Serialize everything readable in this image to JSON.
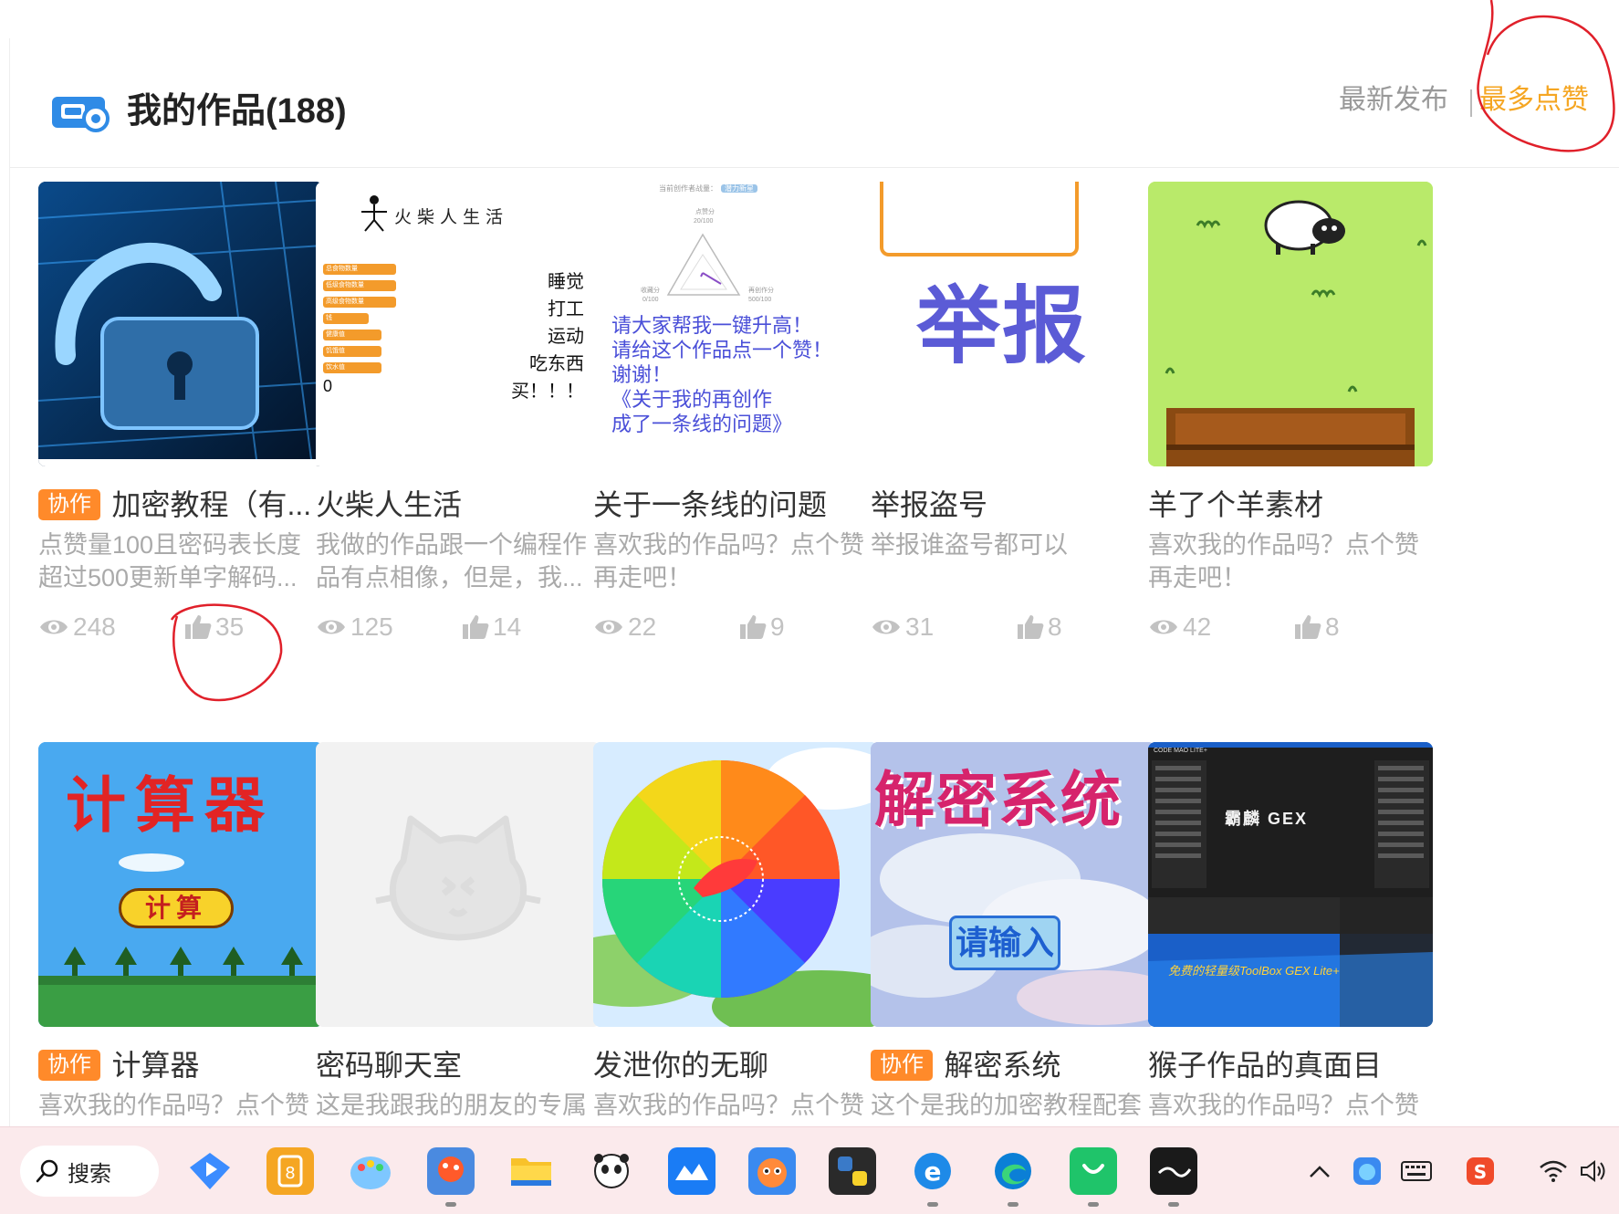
{
  "header": {
    "title": "我的作品(188)",
    "sort_latest": "最新发布",
    "sort_most_liked": "最多点赞"
  },
  "works": [
    {
      "collab": true,
      "badge": "协作",
      "title": "加密教程（有...",
      "desc": "点赞量100且密码表长度超过500更新单字解码...",
      "views": "248",
      "likes": "35"
    },
    {
      "collab": false,
      "badge": "",
      "title": "火柴人生活",
      "desc": "我做的作品跟一个编程作品有点相像，但是，我...",
      "views": "125",
      "likes": "14"
    },
    {
      "collab": false,
      "badge": "",
      "title": "关于一条线的问题",
      "desc": "喜欢我的作品吗？点个赞再走吧！",
      "views": "22",
      "likes": "9"
    },
    {
      "collab": false,
      "badge": "",
      "title": "举报盗号",
      "desc": "举报谁盗号都可以",
      "views": "31",
      "likes": "8"
    },
    {
      "collab": false,
      "badge": "",
      "title": "羊了个羊素材",
      "desc": "喜欢我的作品吗？点个赞再走吧！",
      "views": "42",
      "likes": "8"
    },
    {
      "collab": true,
      "badge": "协作",
      "title": "计算器",
      "desc": "喜欢我的作品吗？点个赞",
      "views": "",
      "likes": ""
    },
    {
      "collab": false,
      "badge": "",
      "title": "密码聊天室",
      "desc": "这是我跟我的朋友的专属",
      "views": "",
      "likes": ""
    },
    {
      "collab": false,
      "badge": "",
      "title": "发泄你的无聊",
      "desc": "喜欢我的作品吗？点个赞",
      "views": "",
      "likes": ""
    },
    {
      "collab": true,
      "badge": "协作",
      "title": "解密系统",
      "desc": "这个是我的加密教程配套",
      "views": "",
      "likes": ""
    },
    {
      "collab": false,
      "badge": "",
      "title": "猴子作品的真面目",
      "desc": "喜欢我的作品吗？点个赞",
      "views": "",
      "likes": ""
    }
  ],
  "thumbs": {
    "stickman_title": "火柴人生活",
    "stickman_list": [
      "总食物数量",
      "低级食物数量",
      "高级食物数量",
      "钱",
      "健康值",
      "饥饿值",
      "饮水值"
    ],
    "stickman_zero": "0",
    "stickman_menu": [
      "睡觉",
      "打工",
      "运动",
      "吃东西",
      "买！！！"
    ],
    "line_top": "当前创作者战量：",
    "line_top_tag": "潜力新星",
    "line_axis_top": "点赞分",
    "line_axis_top_val": "20/100",
    "line_axis_left": "收藏分",
    "line_axis_left_val": "0/100",
    "line_axis_right": "再创作分",
    "line_axis_right_val": "500/100",
    "line_text": [
      "请大家帮我一键升高！",
      "请给这个作品点一个赞！",
      "谢谢！",
      "《关于我的再创作",
      "成了一条线的问题》"
    ],
    "report_text": "举报",
    "calc_title": "计算器",
    "calc_button": "计算",
    "decrypt_title": "解密系统",
    "decrypt_button": "请输入",
    "monkey_header": "CODE MAO LITE+",
    "monkey_center": "霸麟 GEX",
    "monkey_footer": "免费的轻量级ToolBox GEX Lite+"
  },
  "taskbar": {
    "search_label": "搜索"
  },
  "colors": {
    "accent": "#f5a623",
    "badge": "#ff8a2a",
    "muted": "#aaaaaa",
    "annotation": "#e0202a"
  }
}
